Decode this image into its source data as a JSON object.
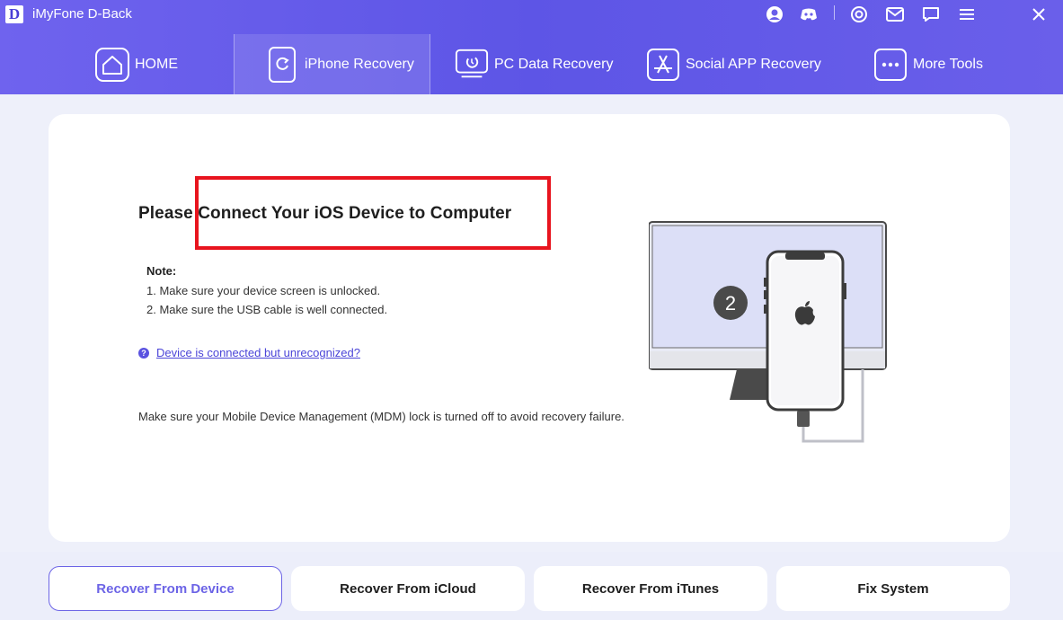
{
  "app": {
    "logo_letter": "D",
    "title": "iMyFone D-Back"
  },
  "titlebar_icons": [
    "account-icon",
    "discord-icon",
    "settings-target-icon",
    "mail-icon",
    "chat-icon",
    "menu-icon",
    "close-icon"
  ],
  "nav": {
    "items": [
      {
        "label": "HOME",
        "icon": "home-icon"
      },
      {
        "label": "iPhone Recovery",
        "icon": "iphone-refresh-icon",
        "active": true
      },
      {
        "label": "PC Data Recovery",
        "icon": "pc-restore-icon"
      },
      {
        "label": "Social APP Recovery",
        "icon": "app-store-icon"
      },
      {
        "label": "More Tools",
        "icon": "more-dots-icon"
      }
    ]
  },
  "main": {
    "headline": "Please Connect Your iOS Device to Computer",
    "note_title": "Note:",
    "notes": [
      "1. Make sure your device screen is unlocked.",
      "2. Make sure the USB cable is well connected."
    ],
    "help_icon": "?",
    "help_link": "Device is connected but unrecognized?",
    "mdm_text": "Make sure your Mobile Device Management (MDM) lock is turned off to avoid recovery failure.",
    "illustration_step": "2"
  },
  "bottom_tabs": [
    {
      "label": "Recover From Device",
      "active": true
    },
    {
      "label": "Recover From iCloud"
    },
    {
      "label": "Recover From iTunes"
    },
    {
      "label": "Fix System"
    }
  ],
  "colors": {
    "header": "#6059e8",
    "accent": "#6c64e6",
    "highlight": "#e8141e"
  }
}
